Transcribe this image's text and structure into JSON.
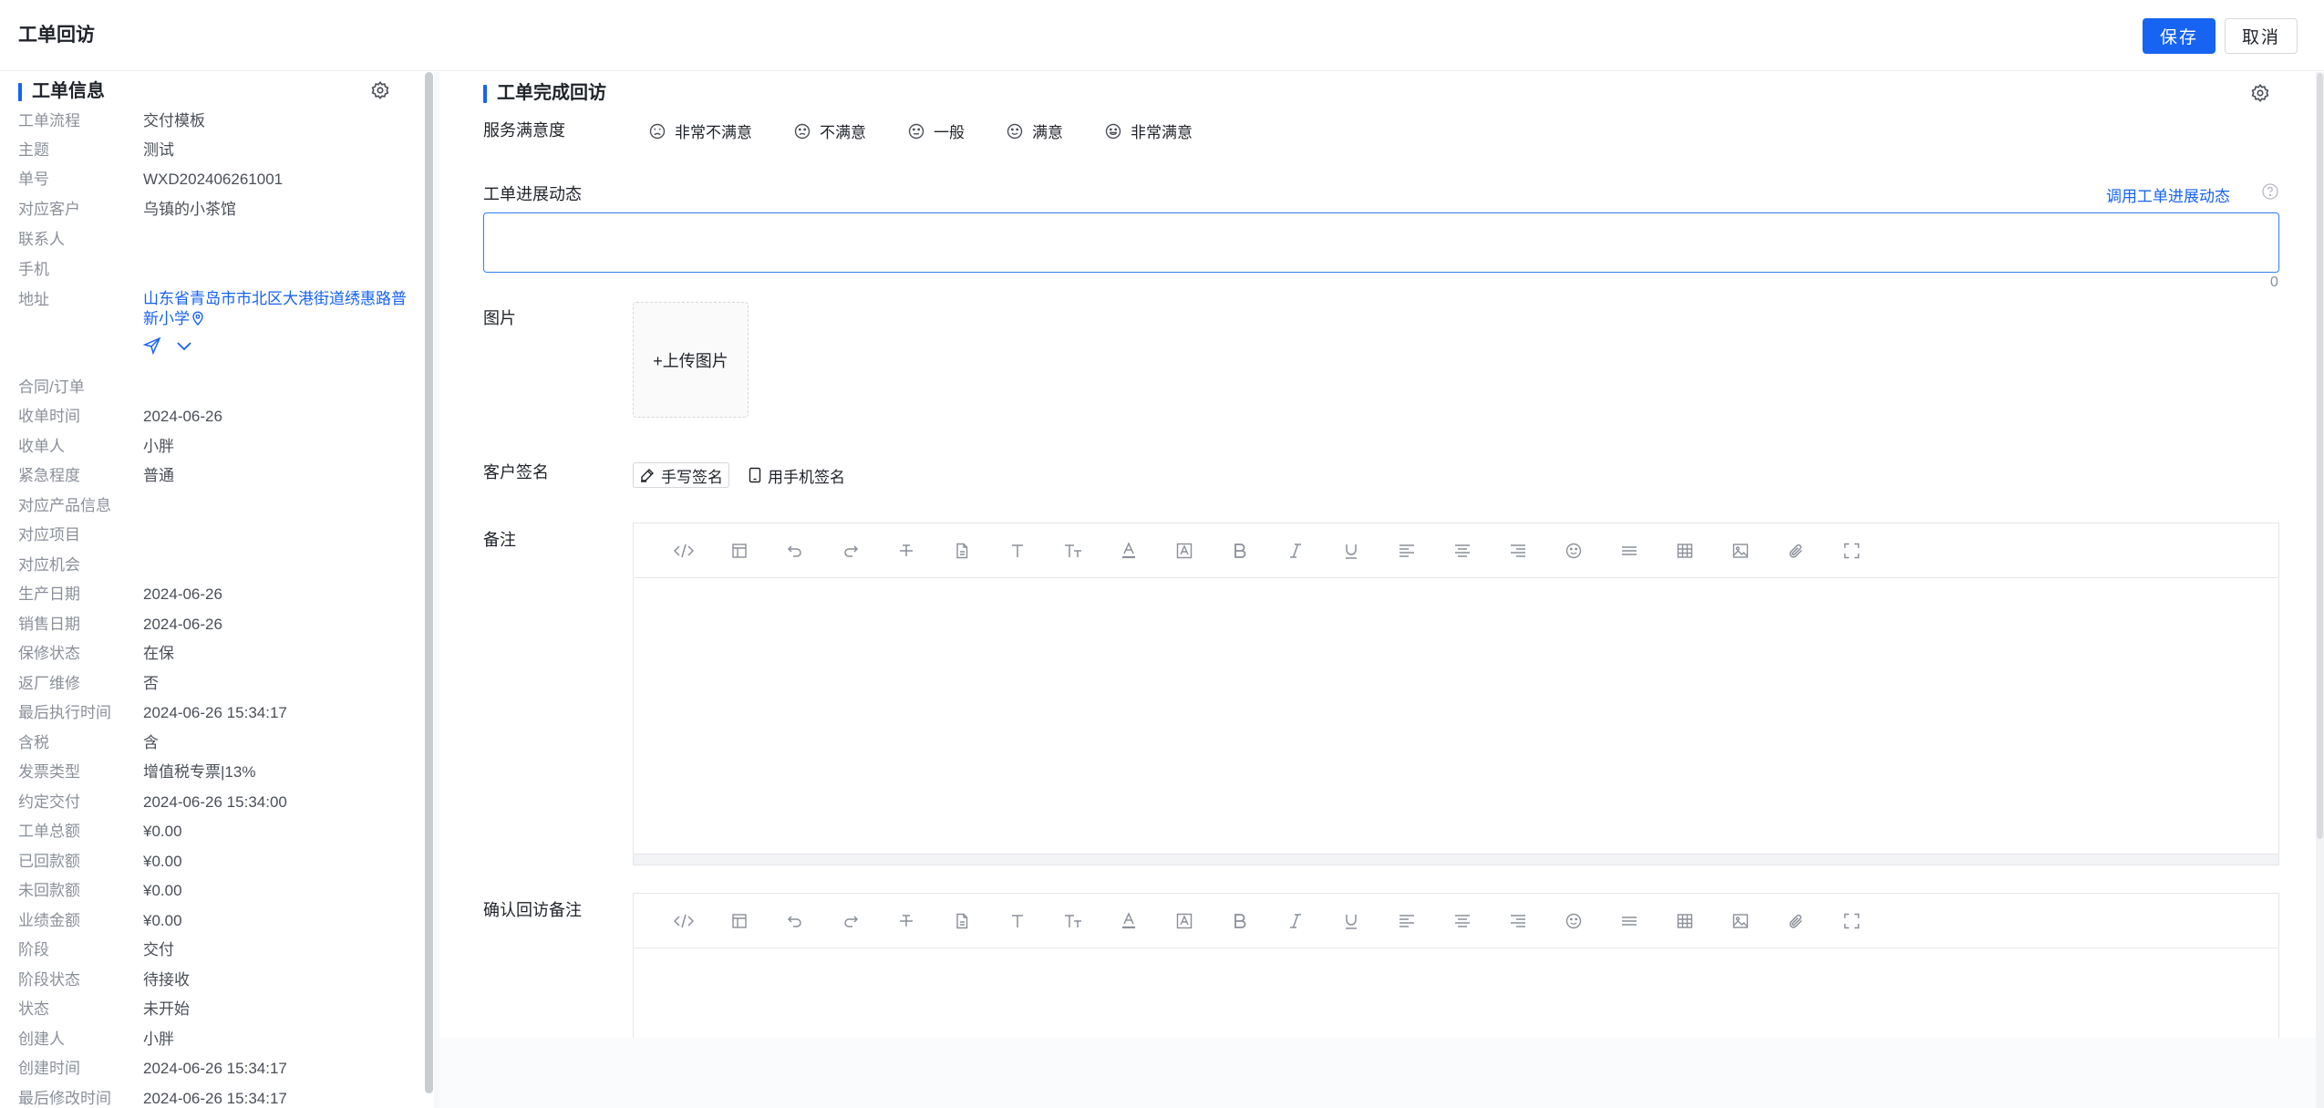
{
  "header": {
    "title": "工单回访",
    "save_label": "保存",
    "cancel_label": "取消"
  },
  "left": {
    "section_title": "工单信息",
    "rows": [
      {
        "label": "工单流程",
        "value": "交付模板"
      },
      {
        "label": "主题",
        "value": "测试"
      },
      {
        "label": "单号",
        "value": "WXD202406261001"
      },
      {
        "label": "对应客户",
        "value": "乌镇的小茶馆"
      },
      {
        "label": "联系人",
        "value": ""
      },
      {
        "label": "手机",
        "value": ""
      },
      {
        "label": "地址",
        "value": "山东省青岛市市北区大港街道绣惠路普新小学"
      },
      {
        "label": "合同/订单",
        "value": ""
      },
      {
        "label": "收单时间",
        "value": "2024-06-26"
      },
      {
        "label": "收单人",
        "value": "小胖"
      },
      {
        "label": "紧急程度",
        "value": "普通"
      },
      {
        "label": "对应产品信息",
        "value": ""
      },
      {
        "label": "对应项目",
        "value": ""
      },
      {
        "label": "对应机会",
        "value": ""
      },
      {
        "label": "生产日期",
        "value": "2024-06-26"
      },
      {
        "label": "销售日期",
        "value": "2024-06-26"
      },
      {
        "label": "保修状态",
        "value": "在保"
      },
      {
        "label": "返厂维修",
        "value": "否"
      },
      {
        "label": "最后执行时间",
        "value": "2024-06-26 15:34:17"
      },
      {
        "label": "含税",
        "value": "含"
      },
      {
        "label": "发票类型",
        "value": "增值税专票|13%"
      },
      {
        "label": "约定交付",
        "value": "2024-06-26 15:34:00"
      },
      {
        "label": "工单总额",
        "value": "¥0.00"
      },
      {
        "label": "已回款额",
        "value": "¥0.00"
      },
      {
        "label": "未回款额",
        "value": "¥0.00"
      },
      {
        "label": "业绩金额",
        "value": "¥0.00"
      },
      {
        "label": "阶段",
        "value": "交付"
      },
      {
        "label": "阶段状态",
        "value": "待接收"
      },
      {
        "label": "状态",
        "value": "未开始"
      },
      {
        "label": "创建人",
        "value": "小胖"
      },
      {
        "label": "创建时间",
        "value": "2024-06-26 15:34:17"
      },
      {
        "label": "最后修改时间",
        "value": "2024-06-26 15:34:17"
      }
    ]
  },
  "right": {
    "section_title": "工单完成回访",
    "satisfaction_label": "服务满意度",
    "satisfaction_options": [
      "非常不满意",
      "不满意",
      "一般",
      "满意",
      "非常满意"
    ],
    "progress_label": "工单进展动态",
    "progress_link": "调用工单进展动态",
    "progress_count": "0",
    "image_label": "图片",
    "upload_label": "+上传图片",
    "signature_label": "客户签名",
    "sign_hand_label": "手写签名",
    "sign_phone_label": "用手机签名",
    "remark_label": "备注",
    "confirm_remark_label": "确认回访备注"
  },
  "colors": {
    "accent": "#1763f2",
    "label_gray": "#8a8f99"
  }
}
